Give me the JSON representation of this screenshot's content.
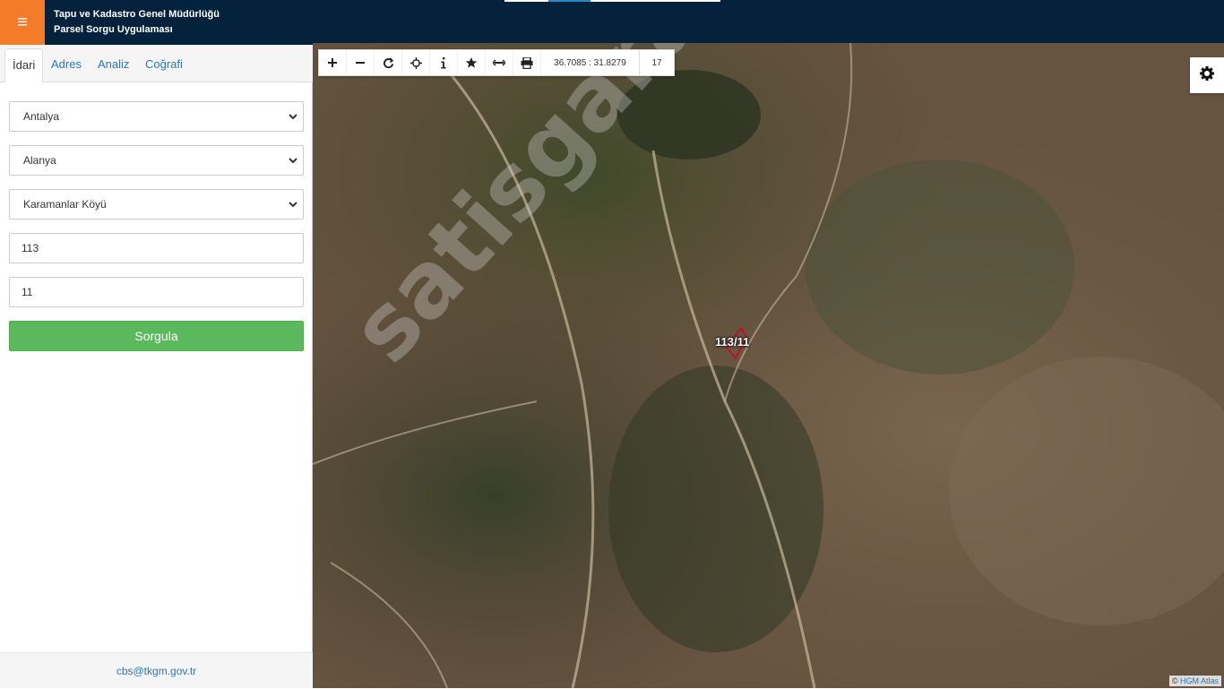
{
  "header": {
    "title_line1": "Tapu ve Kadastro Genel Müdürlüğü",
    "title_line2": "Parsel Sorgu Uygulaması",
    "menu_icon": "hamburger-icon",
    "bg_color": "#04223b",
    "accent_color": "#f47b2a"
  },
  "sidebar": {
    "tabs": [
      {
        "label": "İdari"
      },
      {
        "label": "Adres"
      },
      {
        "label": "Analiz"
      },
      {
        "label": "Coğrafi"
      }
    ],
    "province": "Antalya",
    "district": "Alanya",
    "neighborhood": "Karamanlar Köyü",
    "block_no": "113",
    "parcel_no": "11",
    "submit_label": "Sorgula",
    "footer_email": "cbs@tkgm.gov.tr"
  },
  "map": {
    "coordinates": "36.7085 : 31.8279",
    "zoom_level": "17",
    "parcel_label": "113/11",
    "watermark": "satisgaranti.com",
    "attribution_prefix": "©",
    "attribution_link": "HGM Atlas",
    "tools": [
      "zoom-in-icon",
      "zoom-out-icon",
      "refresh-icon",
      "crosshair-icon",
      "info-icon",
      "star-icon",
      "measure-icon",
      "print-icon"
    ]
  }
}
